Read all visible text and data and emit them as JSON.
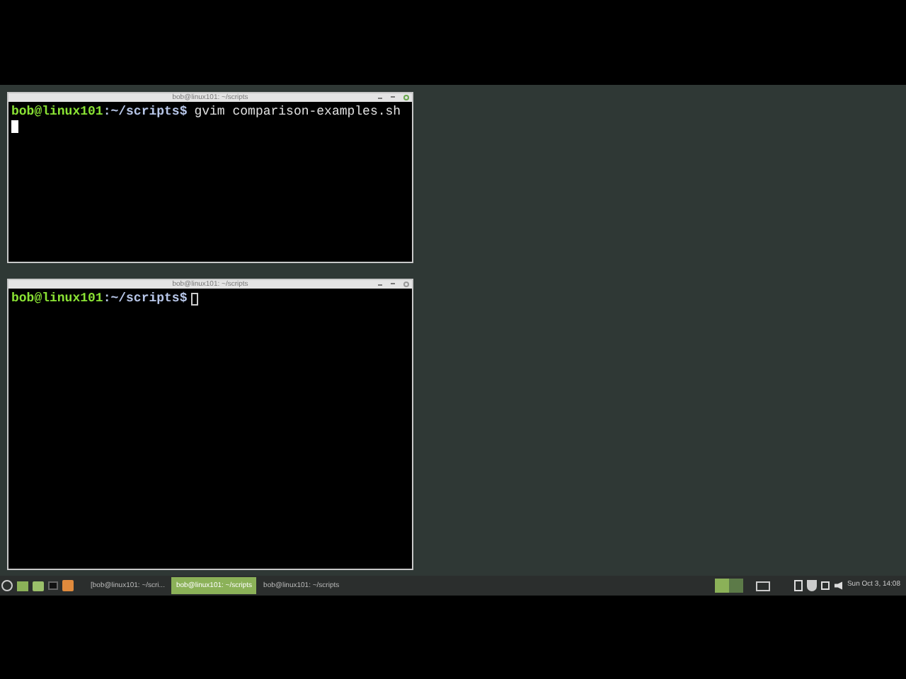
{
  "terminals": [
    {
      "title": "bob@linux101: ~/scripts",
      "focused": true,
      "lines": [
        {
          "user": "bob@linux101",
          "path": ":~/scripts$",
          "command": "gvim comparison-examples.sh"
        }
      ],
      "cursor_on_new_line": true
    },
    {
      "title": "bob@linux101: ~/scripts",
      "focused": false,
      "lines": [
        {
          "user": "bob@linux101",
          "path": ":~/scripts$"
        }
      ],
      "cursor_on_new_line": false
    }
  ],
  "taskbar": {
    "windows": [
      {
        "label": "[bob@linux101: ~/scri...",
        "selected": false
      },
      {
        "label": "bob@linux101: ~/scripts",
        "selected": true
      },
      {
        "label": "bob@linux101: ~/scripts",
        "selected": false
      }
    ],
    "workspaces": [
      {
        "selected": true
      },
      {
        "selected": false
      }
    ],
    "clock": "Sun Oct 3, 14:08"
  }
}
